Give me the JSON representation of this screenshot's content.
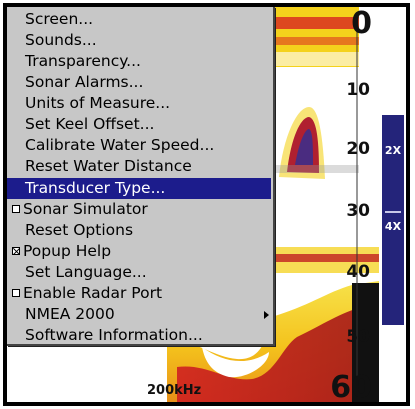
{
  "screen": {
    "frequency": "200kHz",
    "depth_scale": [
      "0",
      "10",
      "20",
      "30",
      "40",
      "50",
      "60"
    ],
    "zoom": {
      "upper": "2X",
      "lower": "4X"
    }
  },
  "menu": {
    "items": [
      {
        "label": "Screen...",
        "kind": "plain"
      },
      {
        "label": "Sounds...",
        "kind": "plain"
      },
      {
        "label": "Transparency...",
        "kind": "plain"
      },
      {
        "label": "Sonar Alarms...",
        "kind": "plain"
      },
      {
        "label": "Units of Measure...",
        "kind": "plain"
      },
      {
        "label": "Set Keel Offset...",
        "kind": "plain"
      },
      {
        "label": "Calibrate Water Speed...",
        "kind": "plain"
      },
      {
        "label": "Reset Water Distance",
        "kind": "plain"
      },
      {
        "label": "Transducer Type...",
        "kind": "selected"
      },
      {
        "label": "Sonar Simulator",
        "kind": "checkbox",
        "checked": false
      },
      {
        "label": "Reset Options",
        "kind": "plain"
      },
      {
        "label": "Popup Help",
        "kind": "checkbox",
        "checked": true
      },
      {
        "label": "Set Language...",
        "kind": "plain"
      },
      {
        "label": "Enable Radar Port",
        "kind": "checkbox",
        "checked": false
      },
      {
        "label": "NMEA 2000",
        "kind": "submenu"
      },
      {
        "label": "Software Information...",
        "kind": "plain"
      }
    ]
  },
  "colors": {
    "selection": "#1c1c8c",
    "menu_bg": "#c7c7c7",
    "zoom_bar": "#24247a",
    "sonar_yellow": "#f4d21c",
    "sonar_red": "#c0202a"
  }
}
